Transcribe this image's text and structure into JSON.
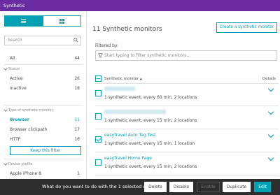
{
  "app": {
    "title": "Synthetic"
  },
  "sidebar": {
    "search_placeholder": "Search",
    "all": {
      "label": "All",
      "count": "44"
    },
    "status_section": "Status",
    "status": [
      {
        "label": "Active",
        "count": "26"
      },
      {
        "label": "Inactive",
        "count": "18"
      }
    ],
    "type_section": "Type of synthetic monitor",
    "types": [
      {
        "label": "Browser",
        "count": "11",
        "selected": true
      },
      {
        "label": "Browser clickpath",
        "count": "17"
      },
      {
        "label": "HTTP",
        "count": "16"
      }
    ],
    "keep_filter_label": "Keep this filter",
    "device_section": "Device profile",
    "devices": [
      {
        "label": "Apple iPhone 8",
        "count": "1"
      }
    ]
  },
  "main": {
    "title": "11 Synthetic monitors",
    "create_button": "Create a synthetic monitor",
    "filter_label": "Filtered by:",
    "filter_placeholder": "Start typing to filter synthetic monitors...",
    "table": {
      "col_name": "Synthetic monitor ▴",
      "col_details": "Details",
      "rows": [
        {
          "name": "",
          "desc": "1 synthetic event, every 60 min, 2 locations",
          "checked": false
        },
        {
          "name": "",
          "desc": "1 synthetic event, every 15 min, 2 locations",
          "checked": false
        },
        {
          "name": "easyTravel Auto Tag Test",
          "desc": "1 synthetic event, every 15 min, 1 location",
          "checked": true
        },
        {
          "name": "easyTravel Home Page",
          "desc": "1 synthetic event, every 15 min, 2 locations",
          "checked": false
        }
      ]
    }
  },
  "bulk_bar": {
    "question": "What do you want to do with the 1 selected monitor?",
    "delete": "Delete",
    "disable": "Disable",
    "enable": "Enable",
    "duplicate": "Duplicate",
    "edit": "Edit"
  }
}
